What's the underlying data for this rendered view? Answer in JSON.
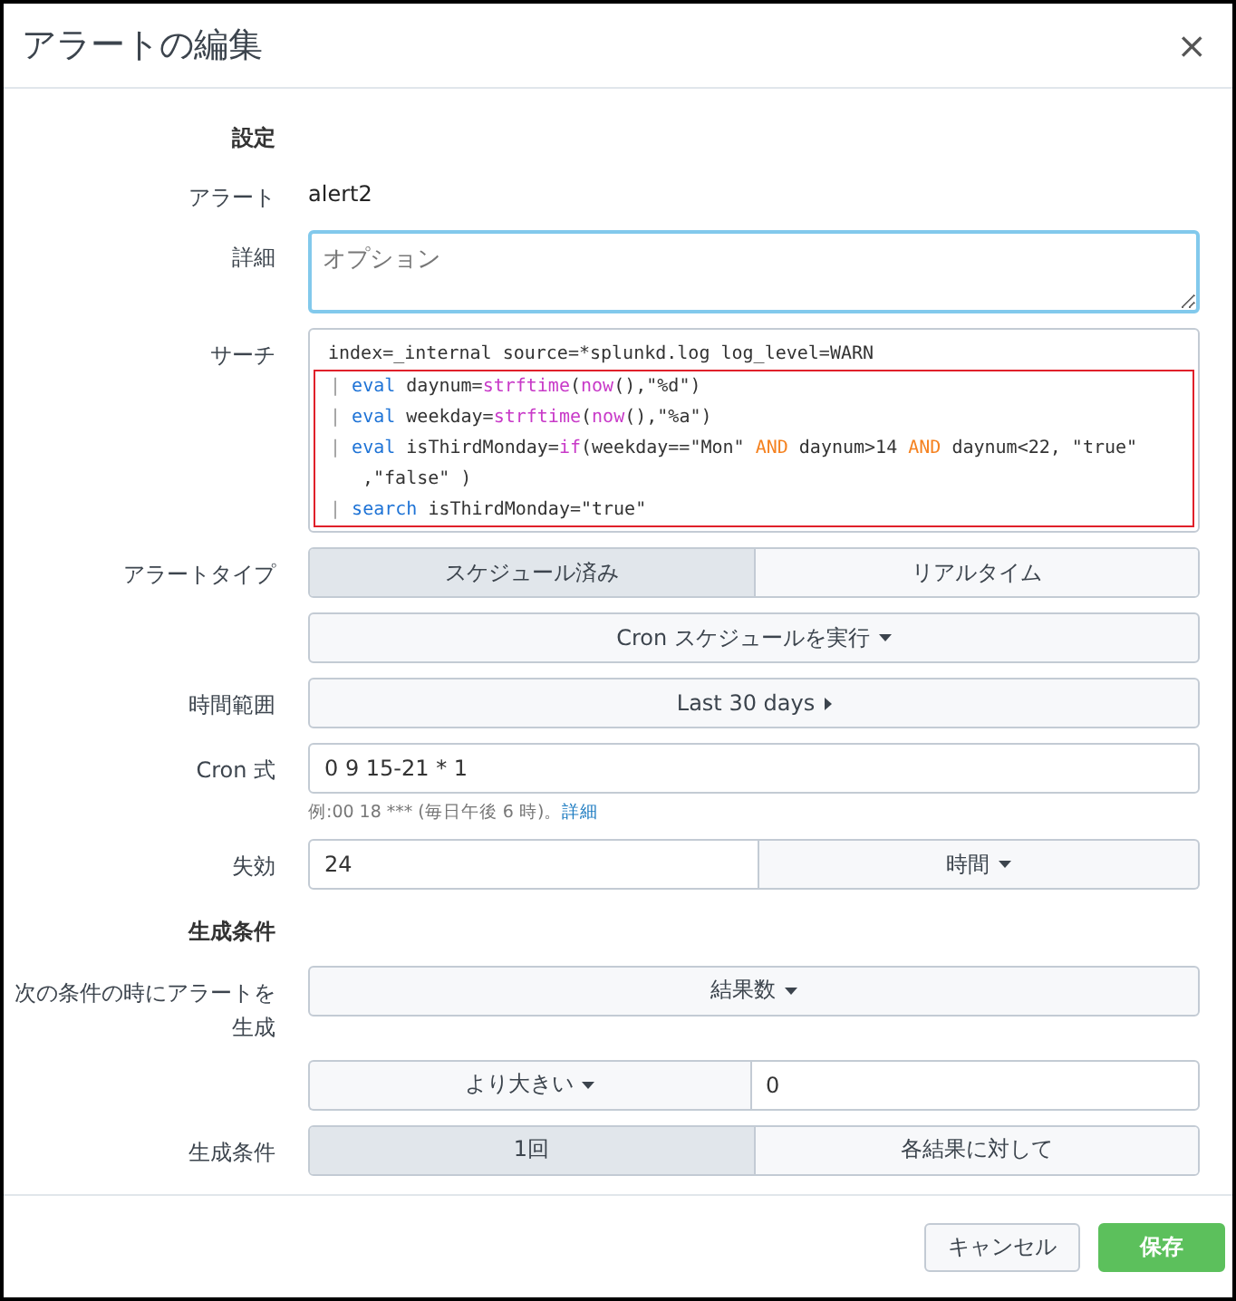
{
  "dialog": {
    "title": "アラートの編集",
    "close": "×"
  },
  "rows": [
    {
      "kind": "heading",
      "label": "設定"
    },
    {
      "kind": "static",
      "label": "アラート",
      "value": "alert2"
    },
    {
      "kind": "textarea",
      "label": "詳細",
      "placeholder": "オプション",
      "focused": true
    },
    {
      "kind": "code",
      "label": "サーチ",
      "lines": [
        {
          "highlighted": false,
          "wrapped": false,
          "tokens": [
            {
              "kind": "plain",
              "text": "index=_internal source=*splunkd.log log_level=WARN"
            }
          ]
        },
        {
          "highlighted": true,
          "wrapped": false,
          "tokens": [
            {
              "kind": "pipe",
              "text": "| "
            },
            {
              "kind": "command",
              "text": "eval"
            },
            {
              "kind": "plain",
              "text": " daynum="
            },
            {
              "kind": "function",
              "text": "strftime"
            },
            {
              "kind": "plain",
              "text": "("
            },
            {
              "kind": "function",
              "text": "now"
            },
            {
              "kind": "plain",
              "text": "(),\"%d\")"
            }
          ]
        },
        {
          "highlighted": true,
          "wrapped": false,
          "tokens": [
            {
              "kind": "pipe",
              "text": "| "
            },
            {
              "kind": "command",
              "text": "eval"
            },
            {
              "kind": "plain",
              "text": " weekday="
            },
            {
              "kind": "function",
              "text": "strftime"
            },
            {
              "kind": "plain",
              "text": "("
            },
            {
              "kind": "function",
              "text": "now"
            },
            {
              "kind": "plain",
              "text": "(),\"%a\")"
            }
          ]
        },
        {
          "highlighted": true,
          "wrapped": false,
          "tokens": [
            {
              "kind": "pipe",
              "text": "| "
            },
            {
              "kind": "command",
              "text": "eval"
            },
            {
              "kind": "plain",
              "text": " isThirdMonday="
            },
            {
              "kind": "function",
              "text": "if"
            },
            {
              "kind": "plain",
              "text": "(weekday==\"Mon\" "
            },
            {
              "kind": "keyword",
              "text": "AND"
            },
            {
              "kind": "plain",
              "text": " daynum>14 "
            },
            {
              "kind": "keyword",
              "text": "AND"
            },
            {
              "kind": "plain",
              "text": " daynum<22, \"true\""
            }
          ]
        },
        {
          "highlighted": true,
          "wrapped": true,
          "tokens": [
            {
              "kind": "plain",
              "text": ",\"false\" )"
            }
          ]
        },
        {
          "highlighted": true,
          "wrapped": false,
          "tokens": [
            {
              "kind": "pipe",
              "text": "| "
            },
            {
              "kind": "command",
              "text": "search"
            },
            {
              "kind": "plain",
              "text": " isThirdMonday=\"true\""
            }
          ]
        }
      ]
    },
    {
      "kind": "segmented",
      "label": "アラートタイプ",
      "options": [
        {
          "label": "スケジュール済み",
          "selected": true
        },
        {
          "label": "リアルタイム",
          "selected": false
        }
      ]
    },
    {
      "kind": "dropdown",
      "value": "Cron スケジュールを実行"
    },
    {
      "kind": "timerange",
      "label": "時間範囲",
      "value": "Last 30 days"
    },
    {
      "kind": "text",
      "label": "Cron 式",
      "value": "0 9 15-21 * 1",
      "help": "例:00 18 *** (毎日午後 6 時)。",
      "help_link": "詳細"
    },
    {
      "kind": "input_dropdown",
      "label": "失効",
      "value": "24",
      "dropdown": "時間"
    },
    {
      "kind": "heading",
      "label": "生成条件"
    },
    {
      "kind": "dropdown",
      "label": "次の条件の時にアラートを生成",
      "value": "結果数"
    },
    {
      "kind": "dropdown_input",
      "dropdown": "より大きい",
      "value": "0"
    },
    {
      "kind": "segmented",
      "label": "生成条件",
      "options": [
        {
          "label": "1回",
          "selected": true
        },
        {
          "label": "各結果に対して",
          "selected": false
        }
      ]
    }
  ],
  "buttons": [
    {
      "kind": "secondary",
      "label": "キャンセル"
    },
    {
      "kind": "primary",
      "label": "保存"
    }
  ]
}
